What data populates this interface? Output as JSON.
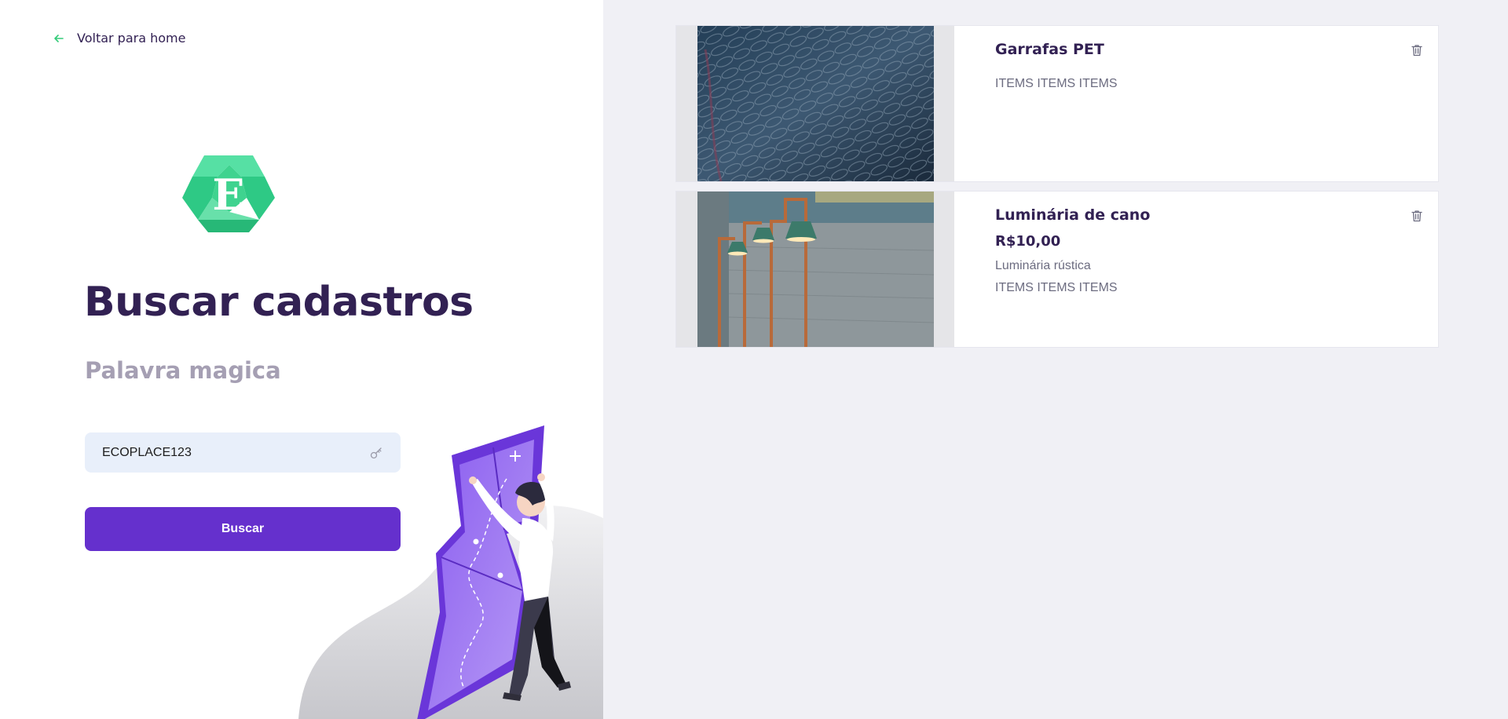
{
  "nav": {
    "back_label": "Voltar para home"
  },
  "logo": {
    "letter": "E"
  },
  "page": {
    "title": "Buscar cadastros",
    "subtitle": "Palavra magica"
  },
  "search": {
    "value": "ECOPLACE123"
  },
  "button": {
    "label": "Buscar"
  },
  "colors": {
    "primary": "#6530cd",
    "accent": "#34cb79",
    "title": "#322153",
    "muted": "#a59fb3",
    "input_bg": "#e8effa"
  },
  "icons": {
    "back": "arrow-left-icon",
    "key": "key-icon",
    "trash": "trash-icon"
  },
  "cards": [
    {
      "name": "Garrafas PET",
      "items": "ITEMS ITEMS ITEMS"
    },
    {
      "name": "Luminária de cano",
      "price": "R$10,00",
      "description": "Luminária rústica",
      "items": "ITEMS ITEMS ITEMS"
    }
  ]
}
